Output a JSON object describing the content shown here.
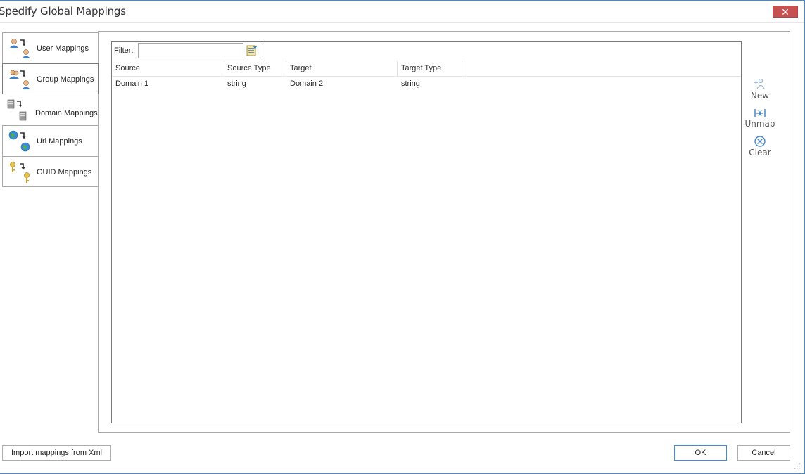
{
  "window": {
    "title": "Spedify Global Mappings",
    "close_symbol": "✕"
  },
  "nav": {
    "items": [
      {
        "label": "User Mappings",
        "icon": "user-mapping-icon"
      },
      {
        "label": "Group Mappings",
        "icon": "group-mapping-icon"
      },
      {
        "label": "Domain Mappings",
        "icon": "domain-mapping-icon"
      },
      {
        "label": "Url Mappings",
        "icon": "url-mapping-icon"
      },
      {
        "label": "GUID Mappings",
        "icon": "guid-mapping-icon"
      }
    ],
    "selected": "Domain Mappings"
  },
  "filter": {
    "label": "Filter:",
    "value": ""
  },
  "grid": {
    "columns": [
      "Source",
      "Source Type",
      "Target",
      "Target Type"
    ],
    "rows": [
      [
        "Domain 1",
        "string",
        "Domain 2",
        "string"
      ]
    ]
  },
  "actions": {
    "new_label": "New",
    "unmap_label": "Unmap",
    "clear_label": "Clear"
  },
  "footer": {
    "import_label": "Import mappings from Xml",
    "ok_label": "OK",
    "cancel_label": "Cancel"
  },
  "colors": {
    "accent": "#3c8fd6",
    "close": "#c75050",
    "border": "#a9a9a9"
  }
}
